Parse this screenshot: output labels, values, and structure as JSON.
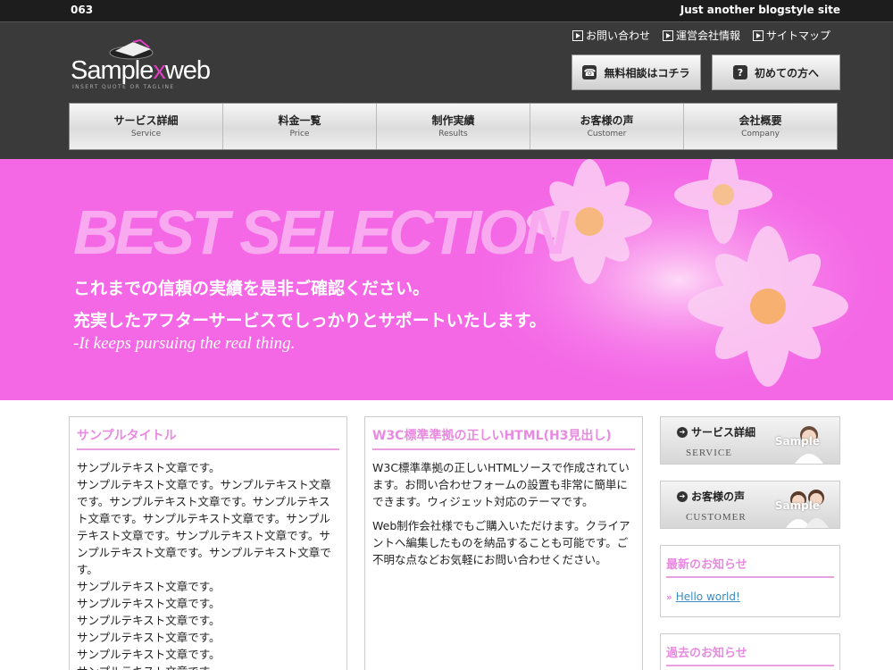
{
  "topbar": {
    "number": "063",
    "tagline": "Just another blogstyle site"
  },
  "logo": {
    "name_a": "Sample",
    "name_x": "x",
    "name_b": "web",
    "sub": "INSERT QUOTE OR TAGLINE"
  },
  "toplinks": [
    {
      "label": "お問い合わせ"
    },
    {
      "label": "運営会社情報"
    },
    {
      "label": "サイトマップ"
    }
  ],
  "header_buttons": {
    "consult": "無料相談はコチラ",
    "firsttime": "初めての方へ"
  },
  "gnav": [
    {
      "jp": "サービス詳細",
      "en": "Service"
    },
    {
      "jp": "料金一覧",
      "en": "Price"
    },
    {
      "jp": "制作実績",
      "en": "Results"
    },
    {
      "jp": "お客様の声",
      "en": "Customer"
    },
    {
      "jp": "会社概要",
      "en": "Company"
    }
  ],
  "hero": {
    "title": "BEST SELECTION",
    "line1": "これまでの信頼の実績を是非ご確認ください。",
    "line2": "充実したアフターサービスでしっかりとサポートいたします。",
    "line3": "-It keeps pursuing the real thing."
  },
  "col1": {
    "title": "サンプルタイトル",
    "lines": [
      "サンプルテキスト文章です。",
      "サンプルテキスト文章です。サンプルテキスト文章です。サンプルテキスト文章です。サンプルテキスト文章です。サンプルテキスト文章です。サンプルテキスト文章です。サンプルテキスト文章です。サンプルテキスト文章です。サンプルテキスト文章です。",
      "サンプルテキスト文章です。",
      "サンプルテキスト文章です。",
      "サンプルテキスト文章です。",
      "サンプルテキスト文章です。",
      "サンプルテキスト文章です。",
      "サンプルテキスト文章です。"
    ]
  },
  "col2": {
    "title": "W3C標準準拠の正しいHTML(H3見出し)",
    "p1": "W3C標準準拠の正しいHTMLソースで作成されています。お問い合わせフォームの設置も非常に簡単にできます。ウィジェット対応のテーマです。",
    "p2": "Web制作会社様でもご購入いただけます。クライアントへ編集したものを納品することも可能です。ご不明な点などお気軽にお問い合わせください。"
  },
  "banners": [
    {
      "jp": "サービス詳細",
      "en": "SERVICE",
      "sample": "Sample"
    },
    {
      "jp": "お客様の声",
      "en": "CUSTOMER",
      "sample": "Sample"
    }
  ],
  "news": {
    "title": "最新のお知らせ",
    "link": "Hello world!"
  },
  "past": {
    "title": "過去のお知らせ"
  },
  "colors": {
    "accent": "#e88ae0",
    "hero_bg": "#f468e6",
    "header_bg": "#3a3a3a"
  }
}
